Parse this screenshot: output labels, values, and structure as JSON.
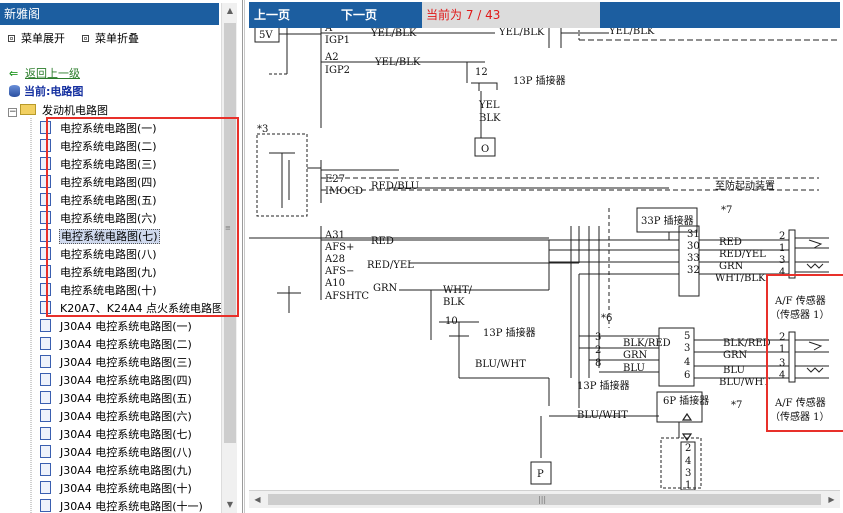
{
  "left_panel": {
    "title": "新雅阁",
    "expand_label": "菜单展开",
    "collapse_label": "菜单折叠",
    "back_label": "返回上一级",
    "current_label": "当前:电路图",
    "folder_label": "发动机电路图",
    "items": [
      "电控系统电路图(一)",
      "电控系统电路图(二)",
      "电控系统电路图(三)",
      "电控系统电路图(四)",
      "电控系统电路图(五)",
      "电控系统电路图(六)",
      "电控系统电路图(七)",
      "电控系统电路图(八)",
      "电控系统电路图(九)",
      "电控系统电路图(十)",
      "K20A7、K24A4 点火系统电路图",
      "J30A4 电控系统电路图(一)",
      "J30A4 电控系统电路图(二)",
      "J30A4 电控系统电路图(三)",
      "J30A4 电控系统电路图(四)",
      "J30A4 电控系统电路图(五)",
      "J30A4 电控系统电路图(六)",
      "J30A4 电控系统电路图(七)",
      "J30A4 电控系统电路图(八)",
      "J30A4 电控系统电路图(九)",
      "J30A4 电控系统电路图(十)",
      "J30A4 电控系统电路图(十一)"
    ],
    "selected_item": "电控系统电路图(七)"
  },
  "toolbar": {
    "prev_label": "上一页",
    "next_label": "下一页",
    "page_info": "当前为 7 / 43"
  },
  "diagram": {
    "labels": {
      "v5": "5V",
      "a_top": "A",
      "igp1": "IGP1",
      "a2": "A2",
      "igp2": "IGP2",
      "yel_blk": "YEL/BLK",
      "pin12": "12",
      "c13p_a": "13P 插接器",
      "yel": "YEL",
      "blk": "BLK",
      "o": "O",
      "star3": "*3",
      "e27": "E27",
      "imocd": "IMOCD",
      "red_blu": "RED/BLU",
      "anti_theft": "至防起动装置",
      "c33p": "33P 插接器",
      "star7a": "*7",
      "a31": "A31",
      "afs_plus": "AFS+",
      "a28": "A28",
      "afs_minus": "AFS−",
      "a10": "A10",
      "afshtc": "AFSHTC",
      "red": "RED",
      "red_yel": "RED/YEL",
      "grn": "GRN",
      "wht_blk": "WHT/BLK",
      "wht": "WHT/",
      "blk2": "BLK",
      "p31": "31",
      "p30": "30",
      "p33": "33",
      "p32": "32",
      "s2": "2",
      "s1": "1",
      "s3": "3",
      "s4": "4",
      "sensor1_a": "A/F 传感器",
      "sensor1_b": "（传感器 1）",
      "pin10": "10",
      "c13p_b": "13P 插接器",
      "blu_wht": "BLU/WHT",
      "star6": "*6",
      "p3": "3",
      "p2": "2",
      "p8": "8",
      "blk_red": "BLK/RED",
      "blu": "BLU",
      "c13p_c": "13P 插接器",
      "q5": "5",
      "q3": "3",
      "q4": "4",
      "q6": "6",
      "blu_wht2": "BLU/WHT",
      "c6p": "6P 插接器",
      "star7b": "*7",
      "sensor2_a": "A/F 传感器",
      "sensor2_b": "（传感器 1）",
      "pbox": "P",
      "b2": "2",
      "b4": "4",
      "b3": "3",
      "b1": "1"
    }
  },
  "colors": {
    "header_blue": "#1c5ea0",
    "highlight_red": "#e8302a",
    "page_text_red": "#e01818",
    "link_green": "#2a7c2a"
  }
}
